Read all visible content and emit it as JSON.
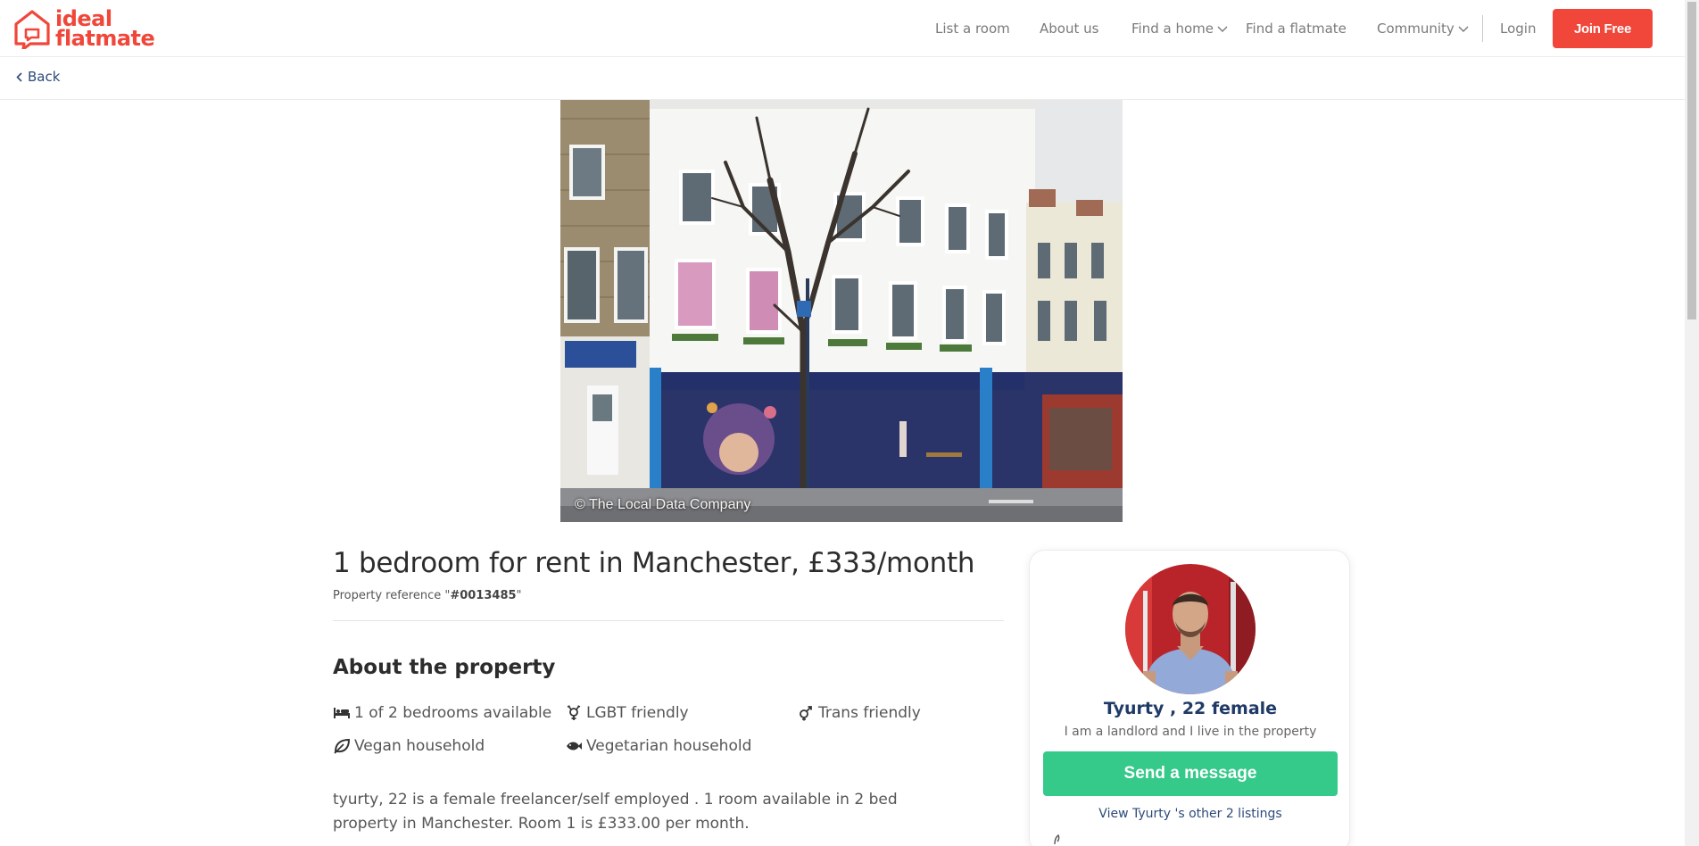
{
  "brand": {
    "line1": "ideal",
    "line2": "flatmate",
    "color": "#f0473a"
  },
  "nav": {
    "items": [
      {
        "label": "List a room",
        "has_dropdown": false
      },
      {
        "label": "About us",
        "has_dropdown": false
      },
      {
        "label": "Find a home",
        "has_dropdown": true
      },
      {
        "label": "Find a flatmate",
        "has_dropdown": false
      },
      {
        "label": "Community",
        "has_dropdown": true
      },
      {
        "label": "Login",
        "has_dropdown": false
      }
    ],
    "join_label": "Join Free"
  },
  "back_label": "Back",
  "photo": {
    "caption": "© The Local Data Company"
  },
  "listing": {
    "title": "1 bedroom for rent in Manchester, £333/month",
    "ref_label": "Property reference \"",
    "ref_value": "#0013485",
    "ref_close": "\"",
    "section_title": "About the property",
    "features": [
      {
        "icon": "bed-icon",
        "label": "1 of 2 bedrooms available"
      },
      {
        "icon": "lgbt-icon",
        "label": "LGBT friendly"
      },
      {
        "icon": "trans-icon",
        "label": "Trans friendly"
      },
      {
        "icon": "leaf-icon",
        "label": "Vegan household"
      },
      {
        "icon": "fish-icon",
        "label": "Vegetarian household"
      }
    ],
    "description": "tyurty, 22 is a female freelancer/self employed . 1 room available in 2 bed property in Manchester. Room 1 is £333.00 per month."
  },
  "host": {
    "name": "Tyurty , 22 female",
    "subtitle": "I am a landlord and I live in the property",
    "message_label": "Send a message",
    "listings_label": "View Tyurty 's other 2 listings"
  },
  "colors": {
    "accent_red": "#f0473a",
    "green": "#35c98a",
    "navy": "#1f3a66"
  }
}
